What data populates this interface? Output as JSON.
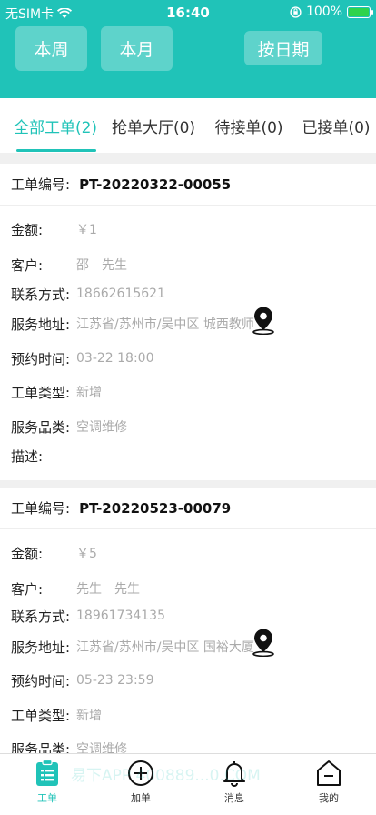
{
  "status_bar": {
    "carrier": "无SIM卡",
    "time": "16:40",
    "battery": "100%"
  },
  "filters": {
    "week": "本周",
    "month": "本月",
    "by_date": "按日期"
  },
  "tabs": [
    {
      "label": "全部工单(2)"
    },
    {
      "label": "抢单大厅(0)"
    },
    {
      "label": "待接单(0)"
    },
    {
      "label": "已接单(0)"
    }
  ],
  "labels": {
    "order_no": "工单编号:",
    "amount": "金额:",
    "customer": "客户:",
    "contact": "联系方式:",
    "address": "服务地址:",
    "appointment": "预约时间:",
    "order_type": "工单类型:",
    "category": "服务品类:",
    "description": "描述:"
  },
  "orders": [
    {
      "order_no": "PT-20220322-00055",
      "amount": "￥1",
      "customer": "邵　先生",
      "contact": "18662615621",
      "address": "江苏省/苏州市/吴中区 城西教师",
      "appointment": "03-22 18:00",
      "order_type": "新增",
      "category": "空调维修",
      "description": ""
    },
    {
      "order_no": "PT-20220523-00079",
      "amount": "￥5",
      "customer": "先生　先生",
      "contact": "18961734135",
      "address": "江苏省/苏州市/吴中区 国裕大厦",
      "appointment": "05-23 23:59",
      "order_type": "新增",
      "category": "空调维修"
    }
  ],
  "bottom_nav": [
    {
      "label": "工单",
      "icon": "clipboard-icon"
    },
    {
      "label": "加单",
      "icon": "plus-circle-icon"
    },
    {
      "label": "消息",
      "icon": "bell-icon"
    },
    {
      "label": "我的",
      "icon": "house-icon"
    }
  ],
  "watermark": "易下APP  400889...0.COM",
  "colors": {
    "accent": "#20c3b8",
    "value_text": "#aaaaaa"
  }
}
